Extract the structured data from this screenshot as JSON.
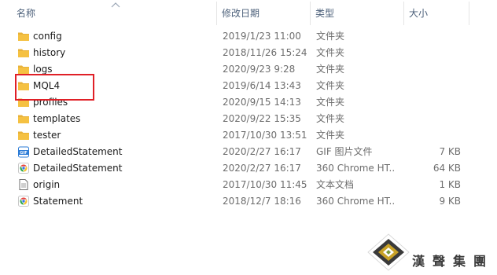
{
  "columns": {
    "name": "名称",
    "date": "修改日期",
    "type": "类型",
    "size": "大小"
  },
  "files": [
    {
      "name": "config",
      "date": "2019/1/23 11:00",
      "type": "文件夹",
      "size": "",
      "icon": "folder-icon"
    },
    {
      "name": "history",
      "date": "2018/11/26 15:24",
      "type": "文件夹",
      "size": "",
      "icon": "folder-icon"
    },
    {
      "name": "logs",
      "date": "2020/9/23 9:28",
      "type": "文件夹",
      "size": "",
      "icon": "folder-icon"
    },
    {
      "name": "MQL4",
      "date": "2019/6/14 13:43",
      "type": "文件夹",
      "size": "",
      "icon": "folder-icon"
    },
    {
      "name": "profiles",
      "date": "2020/9/15 14:13",
      "type": "文件夹",
      "size": "",
      "icon": "folder-icon"
    },
    {
      "name": "templates",
      "date": "2020/9/22 15:35",
      "type": "文件夹",
      "size": "",
      "icon": "folder-icon"
    },
    {
      "name": "tester",
      "date": "2017/10/30 13:51",
      "type": "文件夹",
      "size": "",
      "icon": "folder-icon"
    },
    {
      "name": "DetailedStatement",
      "date": "2020/2/27 16:17",
      "type": "GIF 图片文件",
      "size": "7 KB",
      "icon": "gif-file-icon"
    },
    {
      "name": "DetailedStatement",
      "date": "2020/2/27 16:17",
      "type": "360 Chrome HT...",
      "size": "64 KB",
      "icon": "chrome-html-icon"
    },
    {
      "name": "origin",
      "date": "2017/10/30 11:45",
      "type": "文本文档",
      "size": "1 KB",
      "icon": "text-file-icon"
    },
    {
      "name": "Statement",
      "date": "2018/12/7 18:16",
      "type": "360 Chrome HT...",
      "size": "9 KB",
      "icon": "chrome-html-icon"
    }
  ],
  "gif_icon_label": "GIF",
  "watermark": {
    "text": "漢聲集團",
    "icon": "hansheng-logo-icon"
  },
  "colors": {
    "highlight": "#e02027",
    "folder": "#f5c142",
    "header_text": "#4c607a",
    "secondary_text": "#6d6d6d"
  }
}
